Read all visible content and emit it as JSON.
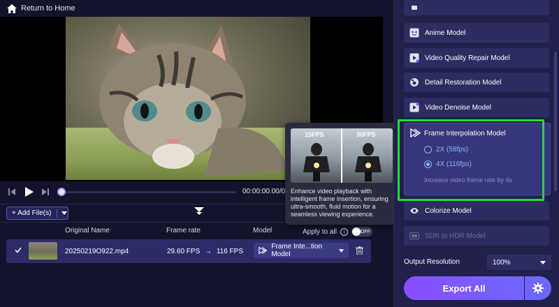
{
  "topbar": {
    "return_label": "Return to Home"
  },
  "player": {
    "timecode": "00:00:00.00/0"
  },
  "toolbar": {
    "add_files_label": "+ Add File(s)"
  },
  "table": {
    "headers": {
      "original_name": "Original Name",
      "frame_rate": "Frame rate",
      "model": "Model",
      "apply_to_all": "Apply to all"
    },
    "toggle_label": "OFF",
    "rows": [
      {
        "filename": "20250219O922.mp4",
        "fps_from": "29.60 FPS",
        "arrow": "→",
        "fps_to": "116 FPS",
        "model": "Frame Inte...tion Model"
      }
    ]
  },
  "tooltip": {
    "label_left": "15FPS",
    "label_right": "30FPS",
    "text": "Enhance video playback with intelligent frame insertion, ensuring ultra-smooth, fluid motion for a seamless viewing experience."
  },
  "models": {
    "anime": "Anime Model",
    "quality_repair": "Video Quality Repair Model",
    "detail_restoration": "Detail Restoration Model",
    "denoise": "Video Denoise Model",
    "frame_interpolation": {
      "title": "Frame Interpolation Model",
      "option_2x": "2X (58fps)",
      "option_4x": "4X (116fps)",
      "selected": "4X (116fps)",
      "description": "Increase video frame rate by 4x"
    },
    "colorize": "Colorize Model",
    "sdr_to_hdr": "SDR to HDR Model"
  },
  "output": {
    "label": "Output Resolution",
    "value": "100%"
  },
  "export": {
    "label": "Export All"
  },
  "colors": {
    "accent": "#7b5cff",
    "highlight": "#22dd33",
    "panel": "#20204a",
    "row": "#2c2c68"
  }
}
